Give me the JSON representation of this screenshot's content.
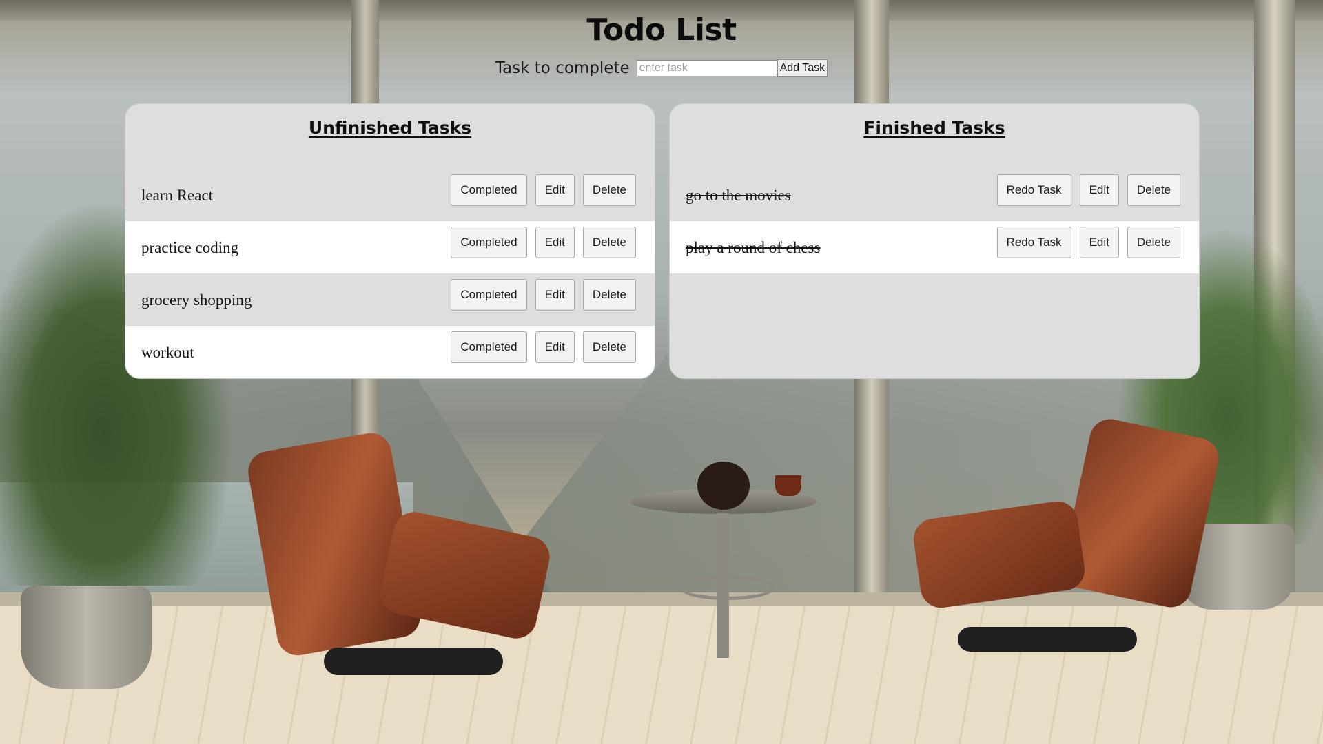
{
  "app": {
    "title": "Todo List"
  },
  "add_task": {
    "label": "Task to complete",
    "input_value": "",
    "input_placeholder": "enter task",
    "button_label": "Add Task"
  },
  "unfinished": {
    "title": "Unfinished Tasks",
    "tasks": [
      {
        "text": "learn React",
        "primary_label": "Completed",
        "edit_label": "Edit",
        "delete_label": "Delete"
      },
      {
        "text": "practice coding",
        "primary_label": "Completed",
        "edit_label": "Edit",
        "delete_label": "Delete"
      },
      {
        "text": "grocery shopping",
        "primary_label": "Completed",
        "edit_label": "Edit",
        "delete_label": "Delete"
      },
      {
        "text": "workout",
        "primary_label": "Completed",
        "edit_label": "Edit",
        "delete_label": "Delete"
      }
    ]
  },
  "finished": {
    "title": "Finished Tasks",
    "tasks": [
      {
        "text": "go to the movies",
        "primary_label": "Redo Task",
        "edit_label": "Edit",
        "delete_label": "Delete"
      },
      {
        "text": "play a round of chess",
        "primary_label": "Redo Task",
        "edit_label": "Edit",
        "delete_label": "Delete"
      }
    ]
  },
  "colors": {
    "panel_bg": "#dedede",
    "row_alt_bg": "#ffffff",
    "button_bg": "#f2f2f2",
    "text": "#151515"
  }
}
